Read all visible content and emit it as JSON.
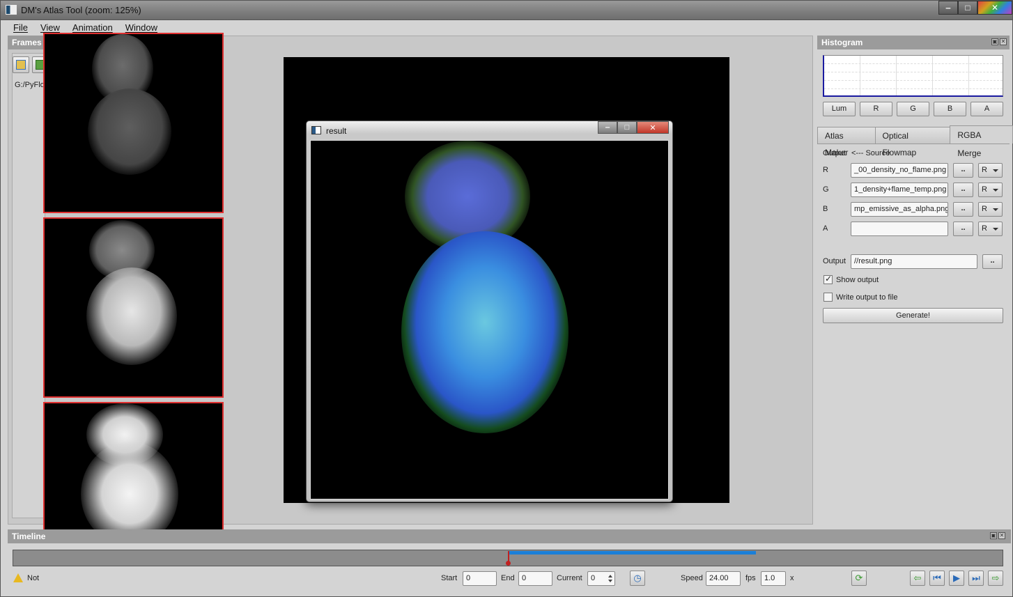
{
  "window": {
    "title": "DM's Atlas Tool (zoom: 125%)"
  },
  "menu": [
    "File",
    "View",
    "Animation",
    "Window"
  ],
  "frames": {
    "title": "Frames",
    "path": "G:/PyFlo"
  },
  "result_window": {
    "title": "result"
  },
  "histogram": {
    "title": "Histogram",
    "channels": [
      "Lum",
      "R",
      "G",
      "B",
      "A"
    ]
  },
  "tabs": [
    {
      "label": "Atlas Maker",
      "active": false
    },
    {
      "label": "Optical Flowmap",
      "active": false
    },
    {
      "label": "RGBA Merge",
      "active": true
    }
  ],
  "merge": {
    "header_output": "Output",
    "header_source": "<--- Source",
    "rows": [
      {
        "channel": "R",
        "file": "_00_density_no_flame.png",
        "button": "..",
        "source": "R"
      },
      {
        "channel": "G",
        "file": "1_density+flame_temp.png",
        "button": "..",
        "source": "R"
      },
      {
        "channel": "B",
        "file": "mp_emissive_as_alpha.png",
        "button": "..",
        "source": "R"
      },
      {
        "channel": "A",
        "file": "",
        "button": "..",
        "source": "R"
      }
    ],
    "output_label": "Output",
    "output_file": "//result.png",
    "output_button": "..",
    "show_output_label": "Show output",
    "show_output": true,
    "write_output_label": "Write output to file",
    "write_output": false,
    "generate_label": "Generate!"
  },
  "timeline": {
    "title": "Timeline",
    "status": "Not",
    "start_label": "Start",
    "start": "0",
    "end_label": "End",
    "end": "0",
    "current_label": "Current",
    "current": "0",
    "speed_label": "Speed",
    "speed": "24.00",
    "fps_label": "fps",
    "multiplier": "1.0",
    "x_label": "x"
  },
  "colors": {
    "accent_blue": "#1a7fd8",
    "thumb_border": "#e03030",
    "dock_title_bg": "#9b9b9b"
  }
}
